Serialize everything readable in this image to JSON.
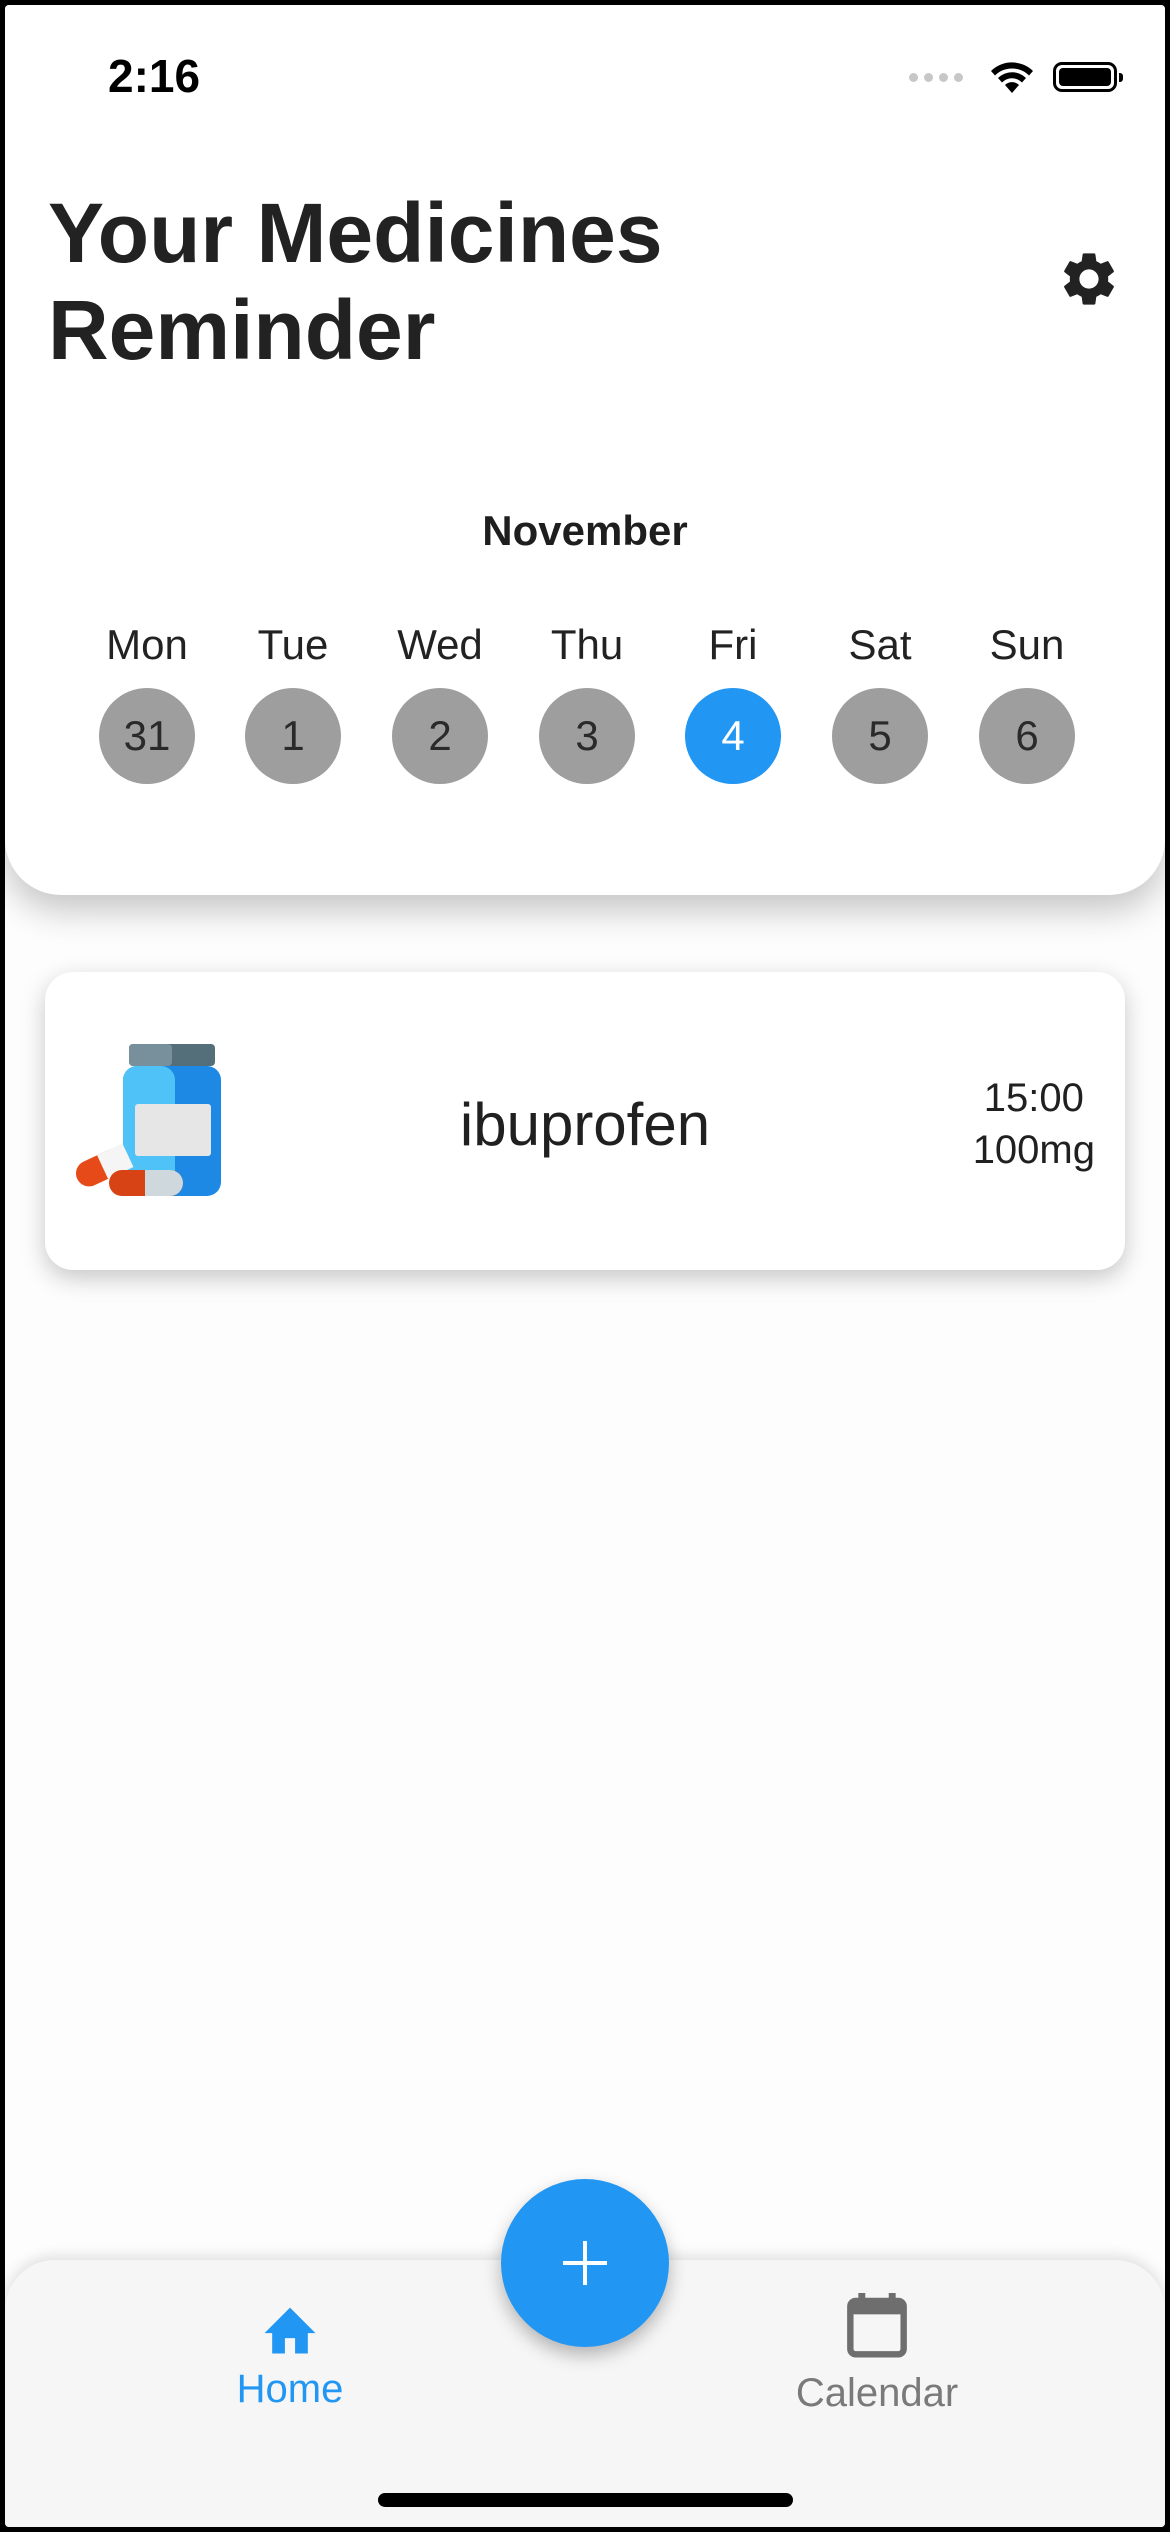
{
  "status_bar": {
    "time": "2:16"
  },
  "header": {
    "title_line1": "Your Medicines",
    "title_line2": "Reminder",
    "settings_icon": "gear-icon"
  },
  "calendar": {
    "month": "November",
    "days": [
      {
        "name": "Mon",
        "num": "31",
        "selected": false
      },
      {
        "name": "Tue",
        "num": "1",
        "selected": false
      },
      {
        "name": "Wed",
        "num": "2",
        "selected": false
      },
      {
        "name": "Thu",
        "num": "3",
        "selected": false
      },
      {
        "name": "Fri",
        "num": "4",
        "selected": true
      },
      {
        "name": "Sat",
        "num": "5",
        "selected": false
      },
      {
        "name": "Sun",
        "num": "6",
        "selected": false
      }
    ]
  },
  "medicines": [
    {
      "name": "ibuprofen",
      "time": "15:00",
      "dose": "100mg",
      "icon": "pill-bottle-icon"
    }
  ],
  "fab": {
    "icon": "plus-icon"
  },
  "bottom_nav": {
    "home_label": "Home",
    "calendar_label": "Calendar"
  },
  "colors": {
    "accent": "#2196f3",
    "day_circle": "#9e9e9e",
    "inactive_nav": "#7a7a7a"
  }
}
